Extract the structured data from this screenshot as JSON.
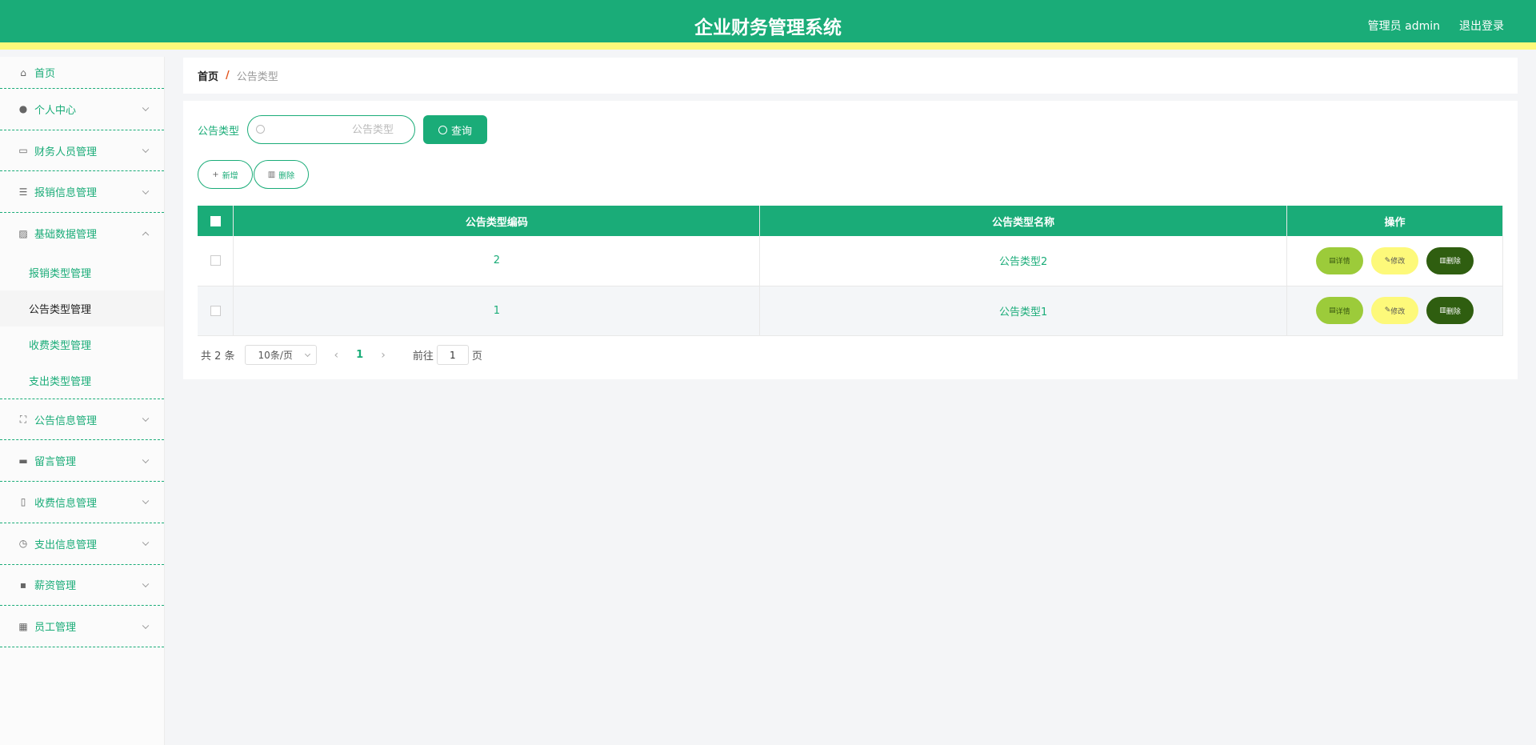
{
  "header": {
    "title": "企业财务管理系统",
    "admin_label": "管理员 admin",
    "logout_label": "退出登录"
  },
  "sidebar": {
    "items": [
      {
        "label": "首页",
        "icon": "home-icon"
      },
      {
        "label": "个人中心",
        "icon": "user-icon"
      },
      {
        "label": "财务人员管理",
        "icon": "chat-icon"
      },
      {
        "label": "报销信息管理",
        "icon": "list-icon"
      },
      {
        "label": "基础数据管理",
        "icon": "chart-icon",
        "expanded": true
      },
      {
        "label": "公告信息管理",
        "icon": "fullscreen-icon"
      },
      {
        "label": "留言管理",
        "icon": "ticket-icon"
      },
      {
        "label": "收费信息管理",
        "icon": "mic-icon"
      },
      {
        "label": "支出信息管理",
        "icon": "clock-icon"
      },
      {
        "label": "薪资管理",
        "icon": "message-icon"
      },
      {
        "label": "员工管理",
        "icon": "grid-icon"
      }
    ],
    "subitems": [
      {
        "label": "报销类型管理"
      },
      {
        "label": "公告类型管理",
        "active": true
      },
      {
        "label": "收费类型管理"
      },
      {
        "label": "支出类型管理"
      }
    ]
  },
  "breadcrumb": {
    "home": "首页",
    "separator": "/",
    "current": "公告类型"
  },
  "search": {
    "label": "公告类型",
    "placeholder": "公告类型",
    "query_label": "查询"
  },
  "actions": {
    "add_label": "新增",
    "delete_label": "删除"
  },
  "table": {
    "columns": [
      "公告类型编码",
      "公告类型名称",
      "操作"
    ],
    "rows": [
      {
        "code": "2",
        "name": "公告类型2"
      },
      {
        "code": "1",
        "name": "公告类型1"
      }
    ],
    "op_detail": "详情",
    "op_edit": "修改",
    "op_delete": "删除"
  },
  "pager": {
    "total": "共 2 条",
    "page_size": "10条/页",
    "current_page": "1",
    "goto_label": "前往",
    "goto_value": "1",
    "page_suffix": "页"
  },
  "colors": {
    "primary": "#1aac78",
    "accent_yellow": "#fdf97a",
    "detail_green": "#9ccb3a",
    "delete_dark": "#2f5e10"
  }
}
